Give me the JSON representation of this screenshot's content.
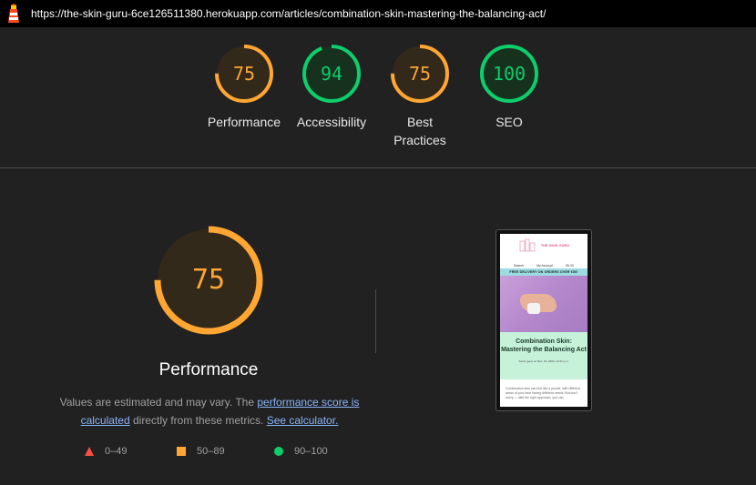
{
  "browser": {
    "url": "https://the-skin-guru-6ce126511380.herokuapp.com/articles/combination-skin-mastering-the-balancing-act/",
    "logo_icon": "lighthouse-icon"
  },
  "summary_gauges": [
    {
      "score": "75",
      "label": "Performance",
      "color": "#ffa633",
      "value": 75
    },
    {
      "score": "94",
      "label": "Accessibility",
      "color": "#0cce6b",
      "value": 94
    },
    {
      "score": "75",
      "label": "Best Practices",
      "color": "#ffa633",
      "value": 75
    },
    {
      "score": "100",
      "label": "SEO",
      "color": "#0cce6b",
      "value": 100
    }
  ],
  "performance": {
    "score": "75",
    "value": 75,
    "color": "#ffa633",
    "title": "Performance",
    "desc_prefix": "Values are estimated and may vary. The ",
    "desc_link1": "performance score is calculated",
    "desc_middle": " directly from these metrics. ",
    "desc_link2": "See calculator."
  },
  "legend": [
    {
      "range": "0–49",
      "shape": "triangle",
      "color": "#ff4e42"
    },
    {
      "range": "50–89",
      "shape": "square",
      "color": "#ffa633"
    },
    {
      "range": "90–100",
      "shape": "circle",
      "color": "#0cce6b"
    }
  ],
  "screenshot": {
    "brand": "THE SKIN GURU",
    "nav": [
      "Search",
      "My Account",
      "€0.00"
    ],
    "banner": "FREE DELIVERY ON ORDERS OVER €50!",
    "title": "Combination Skin: Mastering the Balancing Act",
    "date": "Kevin (gen) on Dec. 15, 2024, 12:41 p.m.",
    "body": "Combination skin can feel like a puzzle, with different areas of your face having different needs. But don't worry — with the right approach, you can"
  },
  "colors": {
    "background": "#212121",
    "average": "#ffa633",
    "pass": "#0cce6b",
    "fail": "#ff4e42",
    "link": "#8ab4f8"
  }
}
